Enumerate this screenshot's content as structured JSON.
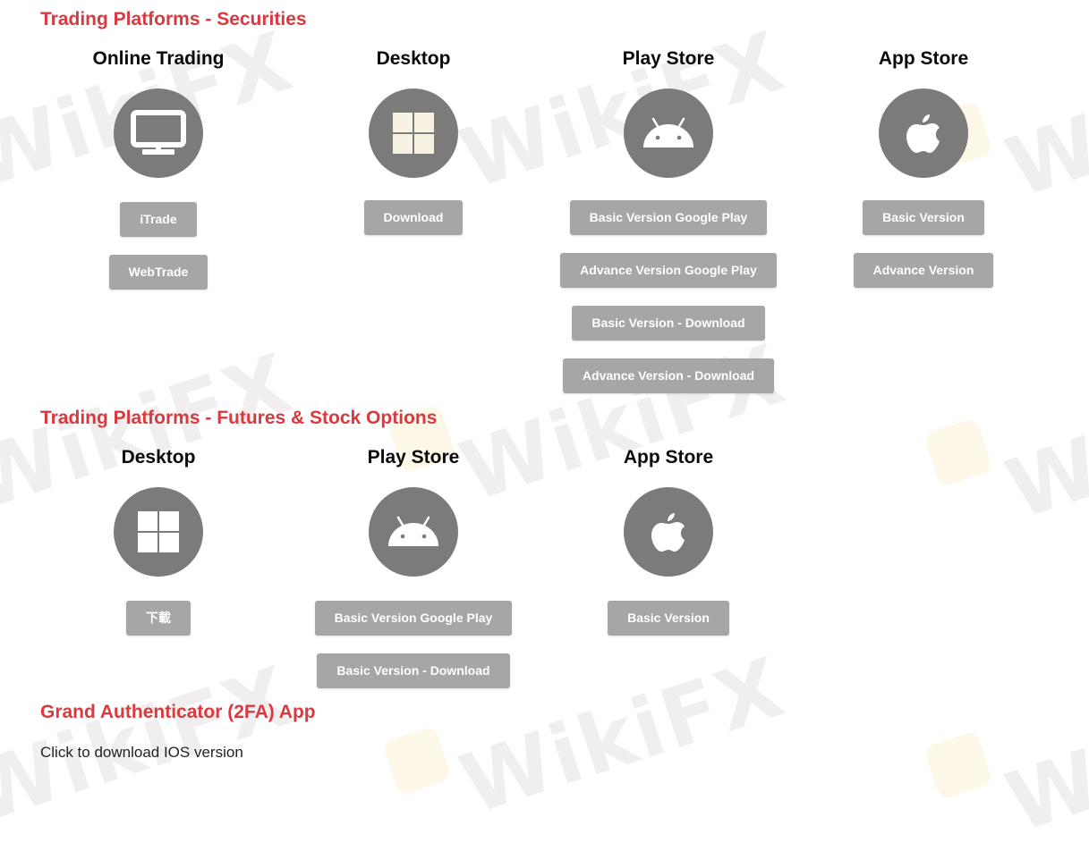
{
  "colors": {
    "heading": "#d83a3f",
    "button_bg": "#a6a6a6",
    "button_text": "#ffffff",
    "icon_circle": "#7b7b7b"
  },
  "watermark": {
    "text": "WikiFX"
  },
  "sections": [
    {
      "title": "Trading Platforms - Securities",
      "columns": [
        {
          "title": "Online Trading",
          "icon": "monitor-icon",
          "buttons": [
            "iTrade",
            "WebTrade"
          ]
        },
        {
          "title": "Desktop",
          "icon": "windows-icon",
          "buttons": [
            "Download"
          ]
        },
        {
          "title": "Play Store",
          "icon": "android-icon",
          "buttons": [
            "Basic Version Google Play",
            "Advance Version Google Play",
            "Basic Version - Download",
            "Advance Version - Download"
          ]
        },
        {
          "title": "App Store",
          "icon": "apple-icon",
          "buttons": [
            "Basic Version",
            "Advance Version"
          ]
        }
      ]
    },
    {
      "title": "Trading Platforms - Futures & Stock Options",
      "columns": [
        {
          "title": "Desktop",
          "icon": "windows-icon",
          "buttons": [
            "下載"
          ]
        },
        {
          "title": "Play Store",
          "icon": "android-icon",
          "buttons": [
            "Basic Version Google Play",
            "Basic Version - Download"
          ]
        },
        {
          "title": "App Store",
          "icon": "apple-icon",
          "buttons": [
            "Basic Version"
          ]
        }
      ]
    },
    {
      "title": "Grand Authenticator (2FA) App",
      "link": "Click to download IOS version"
    }
  ]
}
